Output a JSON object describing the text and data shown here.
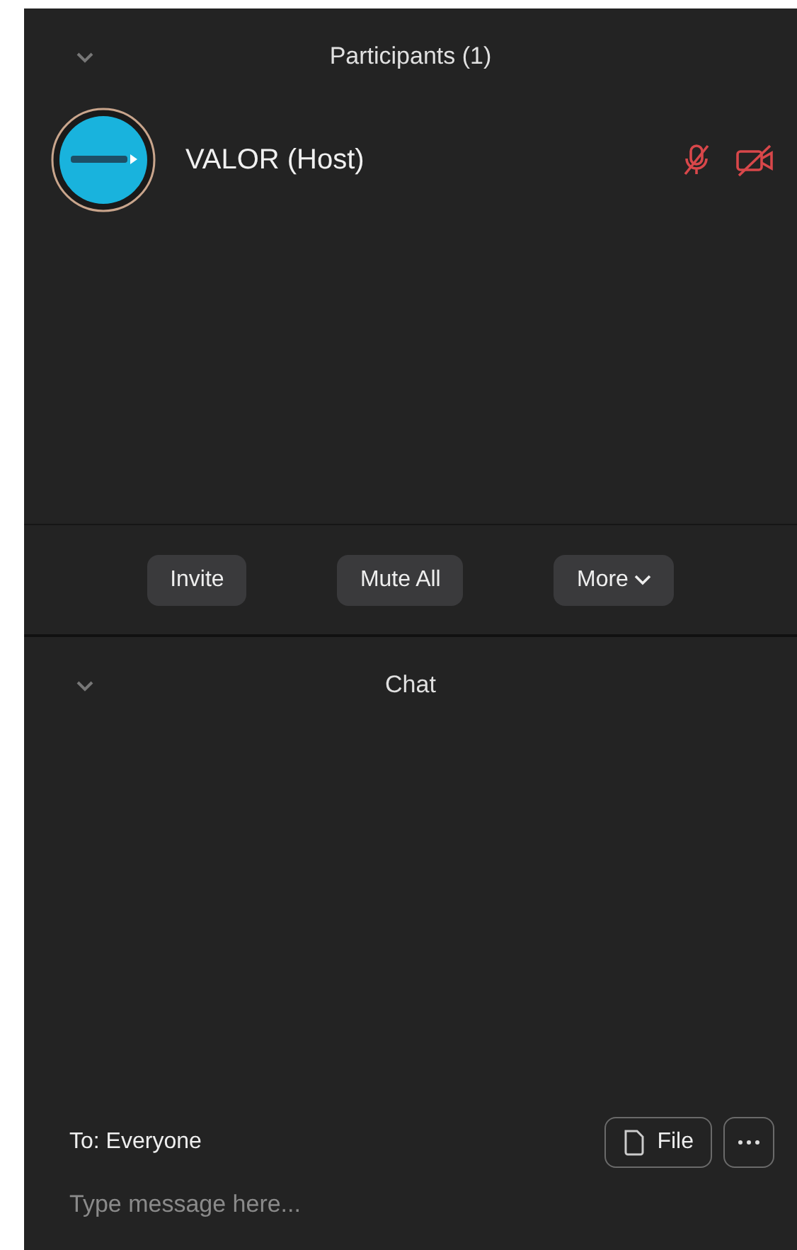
{
  "participants_panel": {
    "title": "Participants (1)",
    "expanded": true
  },
  "participants": [
    {
      "name": "VALOR (Host)",
      "audio_muted": true,
      "video_muted": true
    }
  ],
  "actions": [
    "Invite",
    "Mute All",
    "More"
  ],
  "chat_panel": {
    "title": "Chat",
    "expanded": true
  },
  "chat": {
    "recipient": "To: Everyone",
    "file_button": "File",
    "placeholder": "Type message here..."
  }
}
